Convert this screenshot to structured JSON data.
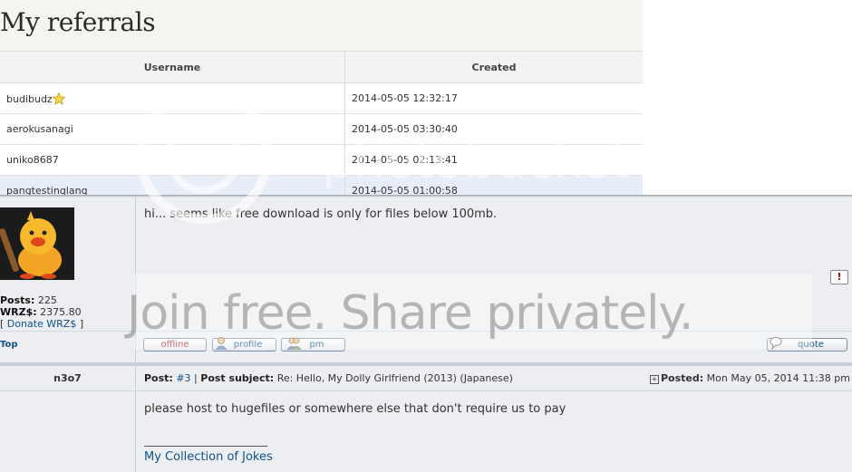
{
  "referrals": {
    "title": "My referrals",
    "columns": [
      "Username",
      "Created"
    ],
    "rows": [
      {
        "username": "budibudz",
        "created": "2014-05-05 12:32:17"
      },
      {
        "username": "aerokusanagi",
        "created": "2014-05-05 03:30:40"
      },
      {
        "username": "uniko8687",
        "created": "2014-05-05 02:13:41"
      },
      {
        "username": "pangtestinglang",
        "created": "2014-05-05 01:00:58"
      }
    ]
  },
  "post1": {
    "text": "hi... seems like free download is only for files below 100mb.",
    "stats": {
      "posts_label": "Posts:",
      "posts_value": "225",
      "wrz_label": "WRZ$:",
      "wrz_value": "2375.80",
      "donate": "Donate WRZ$",
      "donate_open": "[",
      "donate_close": "]"
    },
    "top_link": "Top",
    "buttons": {
      "offline": "offline",
      "profile": "profile",
      "pm": "pm",
      "quote": "quote"
    },
    "report_icon": "!"
  },
  "post2": {
    "author": "n3o7",
    "post_label": "Post:",
    "post_number": "#3",
    "separator": "|",
    "subject_label": "Post subject:",
    "subject": "Re: Hello, My Dolly Girlfriend (2013) (Japanese)",
    "posted_label": "Posted:",
    "posted_value": "Mon May 05, 2014 11:38 pm",
    "text": "please host to hugefiles or somewhere else that don't require us to pay",
    "signature": "My Collection of Jokes"
  },
  "watermarks": {
    "photobucket": "photobucket",
    "tagline": "Join free. Share privately."
  },
  "colors": {
    "link": "#105289",
    "forum_bg": "#eceef1",
    "offline": "#aa2222"
  }
}
